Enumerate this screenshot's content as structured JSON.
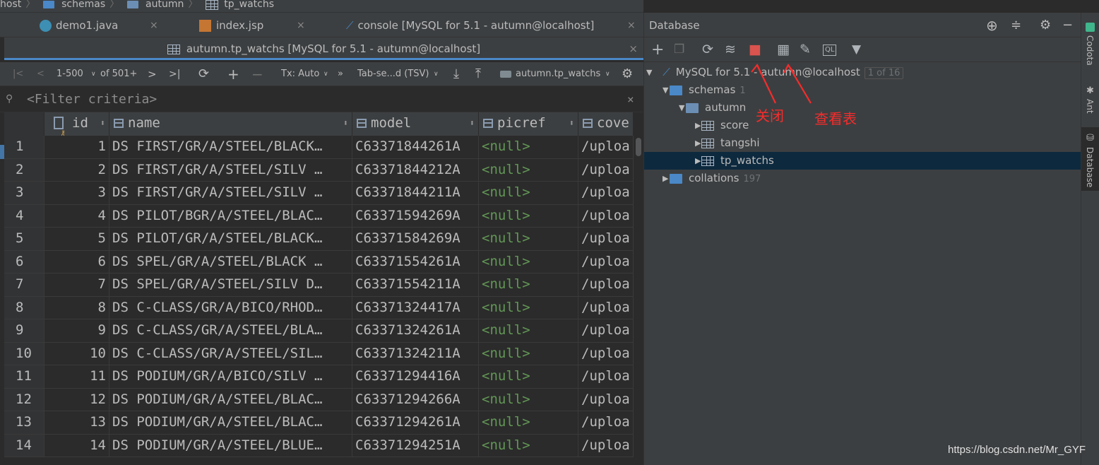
{
  "breadcrumb": {
    "items": [
      "host",
      "schemas",
      "autumn",
      "tp_watchs"
    ]
  },
  "tabs": [
    {
      "label": "demo1.java",
      "close": "×"
    },
    {
      "label": "index.jsp",
      "close": "×"
    },
    {
      "label": "console [MySQL for 5.1 - autumn@localhost]",
      "close": "×"
    }
  ],
  "active_tab": {
    "label": "autumn.tp_watchs [MySQL for 5.1 - autumn@localhost]",
    "close": "×"
  },
  "toolbar": {
    "first": "|<",
    "prev": "<",
    "range": "1-500",
    "sep": "∨",
    "of": "of 501+",
    "next": ">",
    "last": ">|",
    "refresh": "⟳",
    "add": "+",
    "remove": "−",
    "tx": "Tx: Auto",
    "more": "»",
    "format": "Tab-se...d (TSV)",
    "download": "⤓",
    "upload": "⤒",
    "table": "autumn.tp_watchs",
    "settings": "⚙"
  },
  "filter": {
    "placeholder": "<Filter criteria>",
    "close": "×"
  },
  "columns": [
    {
      "label": "id"
    },
    {
      "label": "name"
    },
    {
      "label": "model"
    },
    {
      "label": "picref"
    },
    {
      "label": "cove"
    }
  ],
  "rows": [
    {
      "n": "1",
      "id": "1",
      "name": "DS FIRST/GR/A/STEEL/BLACK…",
      "model": "C63371844261A",
      "picref": "<null>",
      "cover": "/uploa"
    },
    {
      "n": "2",
      "id": "2",
      "name": "DS FIRST/GR/A/STEEL/SILV …",
      "model": "C63371844212A",
      "picref": "<null>",
      "cover": "/uploa"
    },
    {
      "n": "3",
      "id": "3",
      "name": "DS FIRST/GR/A/STEEL/SILV …",
      "model": "C63371844211A",
      "picref": "<null>",
      "cover": "/uploa"
    },
    {
      "n": "4",
      "id": "4",
      "name": "DS PILOT/BGR/A/STEEL/BLAC…",
      "model": "C63371594269A",
      "picref": "<null>",
      "cover": "/uploa"
    },
    {
      "n": "5",
      "id": "5",
      "name": "DS PILOT/GR/A/STEEL/BLACK…",
      "model": "C63371584269A",
      "picref": "<null>",
      "cover": "/uploa"
    },
    {
      "n": "6",
      "id": "6",
      "name": "DS SPEL/GR/A/STEEL/BLACK …",
      "model": "C63371554261A",
      "picref": "<null>",
      "cover": "/uploa"
    },
    {
      "n": "7",
      "id": "7",
      "name": "DS SPEL/GR/A/STEEL/SILV D…",
      "model": "C63371554211A",
      "picref": "<null>",
      "cover": "/uploa"
    },
    {
      "n": "8",
      "id": "8",
      "name": "DS C-CLASS/GR/A/BICO/RHOD…",
      "model": "C63371324417A",
      "picref": "<null>",
      "cover": "/uploa"
    },
    {
      "n": "9",
      "id": "9",
      "name": "DS C-CLASS/GR/A/STEEL/BLA…",
      "model": "C63371324261A",
      "picref": "<null>",
      "cover": "/uploa"
    },
    {
      "n": "10",
      "id": "10",
      "name": "DS C-CLASS/GR/A/STEEL/SIL…",
      "model": "C63371324211A",
      "picref": "<null>",
      "cover": "/uploa"
    },
    {
      "n": "11",
      "id": "11",
      "name": "DS PODIUM/GR/A/BICO/SILV …",
      "model": "C63371294416A",
      "picref": "<null>",
      "cover": "/uploa"
    },
    {
      "n": "12",
      "id": "12",
      "name": "DS PODIUM/GR/A/STEEL/BLAC…",
      "model": "C63371294266A",
      "picref": "<null>",
      "cover": "/uploa"
    },
    {
      "n": "13",
      "id": "13",
      "name": "DS PODIUM/GR/A/STEEL/BLAC…",
      "model": "C63371294261A",
      "picref": "<null>",
      "cover": "/uploa"
    },
    {
      "n": "14",
      "id": "14",
      "name": "DS PODIUM/GR/A/STEEL/BLUE…",
      "model": "C63371294251A",
      "picref": "<null>",
      "cover": "/uploa"
    }
  ],
  "database": {
    "title": "Database",
    "header_icons": {
      "locate": "⊕",
      "collapse": "≑",
      "settings": "⚙",
      "hide": "−"
    },
    "toolbar": {
      "add": "+",
      "copy": "❐",
      "refresh": "⟳",
      "sync": "≋",
      "stop": "■",
      "table": "▦",
      "edit": "✎",
      "console": "QL",
      "filter": "▼"
    },
    "tree": {
      "connection": "MySQL for 5.1 - autumn@localhost",
      "connection_count": "1 of 16",
      "schemas": "schemas",
      "schemas_count": "1",
      "schema": "autumn",
      "tables": [
        "score",
        "tangshi",
        "tp_watchs"
      ],
      "collations": "collations",
      "collations_count": "197"
    },
    "annotations": {
      "close": "关闭",
      "view_table": "查看表"
    }
  },
  "right_strip": {
    "codota": "Codota",
    "ant": "Ant",
    "database": "Database"
  },
  "watermark": "https://blog.csdn.net/Mr_GYF",
  "colors": {
    "accent": "#4a88c7",
    "null": "#629755",
    "annotation": "#f52c2c",
    "selection": "#0d293e",
    "stop": "#d9534f"
  }
}
